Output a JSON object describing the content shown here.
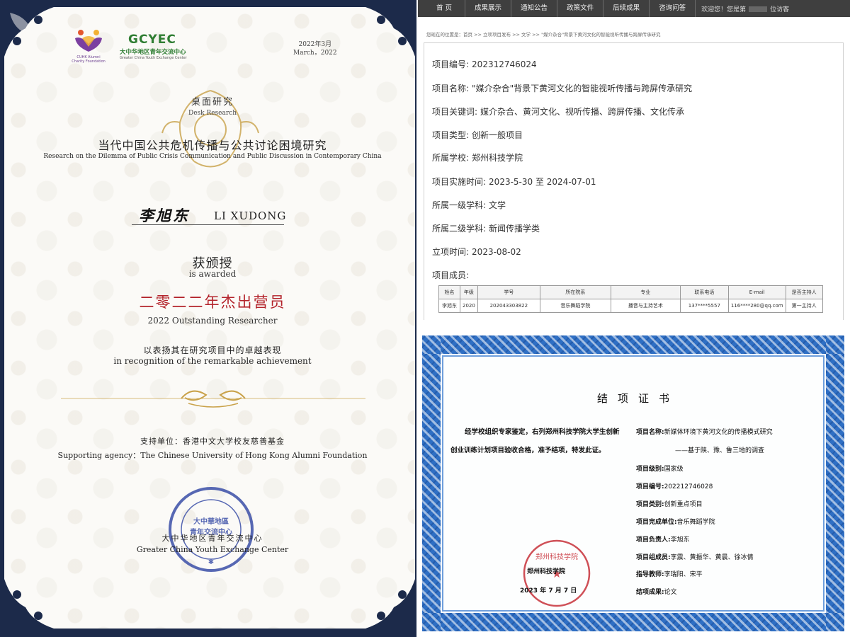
{
  "left_certificate": {
    "logo_cuhk_caption": "CUHK Alumni Charity Foundation",
    "logo_gcyec_abbr": "GCYEC",
    "logo_gcyec_cn": "大中华地区青年交流中心",
    "logo_gcyec_en": "Greater China Youth Exchange Center",
    "date_cn": "2022年3月",
    "date_en": "March，2022",
    "desk_cn": "桌面研究",
    "desk_en": "Desk Research",
    "title_cn": "当代中国公共危机传播与公共讨论困境研究",
    "title_en": "Research on the Dilemma of Public Crisis Communication and Public Discussion in Contemporary China",
    "name_cn": "李旭东",
    "name_en": "LI XUDONG",
    "awarded_cn": "获颁授",
    "awarded_en": "is  awarded",
    "award_cn": "二零二二年杰出营员",
    "award_en": "2022 Outstanding Researcher",
    "recognition_cn": "以表扬其在研究项目中的卓越表现",
    "recognition_en": "in recognition of the remarkable achievement",
    "support_cn": "支持单位：香港中文大学校友慈善基金",
    "support_en": "Supporting agency：The Chinese University of Hong Kong Alumni  Foundation",
    "center_cn": "大中华地区青年交流中心",
    "center_en": "Greater China Youth Exchange Center",
    "stamp_text": "大中華地區 青年交流中心"
  },
  "web_page": {
    "nav": [
      "首 页",
      "成果展示",
      "通知公告",
      "政策文件",
      "后续成果",
      "咨询问答"
    ],
    "welcome": "欢迎您！您是第",
    "visitor_suffix": "位访客",
    "breadcrumb": "您现在的位置是：首页 >> 立项项目发布 >> 文学 >> \"媒介杂合\"背景下黄河文化的智能视听传播与跨屏传承研究",
    "fields": [
      {
        "label": "项目编号:",
        "value": "202312746024"
      },
      {
        "label": "项目名称:",
        "value": "\"媒介杂合\"背景下黄河文化的智能视听传播与跨屏传承研究"
      },
      {
        "label": "项目关键词:",
        "value": "媒介杂合、黄河文化、视听传播、跨屏传播、文化传承"
      },
      {
        "label": "项目类型:",
        "value": "创新一般项目"
      },
      {
        "label": "所属学校:",
        "value": "郑州科技学院"
      },
      {
        "label": "项目实施时间:",
        "value": "2023-5-30 至 2024-07-01"
      },
      {
        "label": "所属一级学科:",
        "value": "文学"
      },
      {
        "label": "所属二级学科:",
        "value": "新闻传播学类"
      },
      {
        "label": "立项时间:",
        "value": "2023-08-02"
      },
      {
        "label": "项目成员:",
        "value": ""
      }
    ],
    "members_table": {
      "headers": [
        "姓名",
        "年级",
        "学号",
        "所在院系",
        "专业",
        "联系电话",
        "E-mail",
        "是否主持人"
      ],
      "rows": [
        [
          "李旭东",
          "2020",
          "202043303822",
          "音乐舞蹈学院",
          "播音与主持艺术",
          "137****5557",
          "116****280@qq.com",
          "第一主持人"
        ]
      ]
    }
  },
  "completion_certificate": {
    "title": "结项证书",
    "body": "经学校组织专家鉴定，右列郑州科技学院大学生创新创业训练计划项目验收合格，准予结项，特发此证。",
    "project_name_label": "项目名称:",
    "project_name": "新媒体环境下黄河文化的传播模式研究",
    "project_subtitle": "——基于陕、豫、鲁三地的调查",
    "level_label": "项目级别:",
    "level": "国家级",
    "number_label": "项目编号:",
    "number": "202212746028",
    "category_label": "项目类别:",
    "category": "创新重点项目",
    "unit_label": "项目完成单位:",
    "unit": "音乐舞蹈学院",
    "leader_label": "项目负责人:",
    "leader": "李旭东",
    "members_label": "项目组成员:",
    "members": "李震、黄振华、黄晨、徐冰倩",
    "advisor_label": "指导教师:",
    "advisors": "李瑞阳、宋平",
    "result_label": "结项成果:",
    "result": "论文",
    "issuer": "郑州科技学院",
    "issue_date": "2023 年 7 月 7 日",
    "seal_text": "郑州科技学院"
  },
  "colors": {
    "navy": "#1c2a4a",
    "award_red": "#b3232b",
    "gold": "#c9a24a",
    "stamp_blue": "#3b4fa8",
    "cert_blue": "#2f6fc4",
    "seal_red": "#c8323a",
    "nav_bg": "#3f3f3f"
  }
}
